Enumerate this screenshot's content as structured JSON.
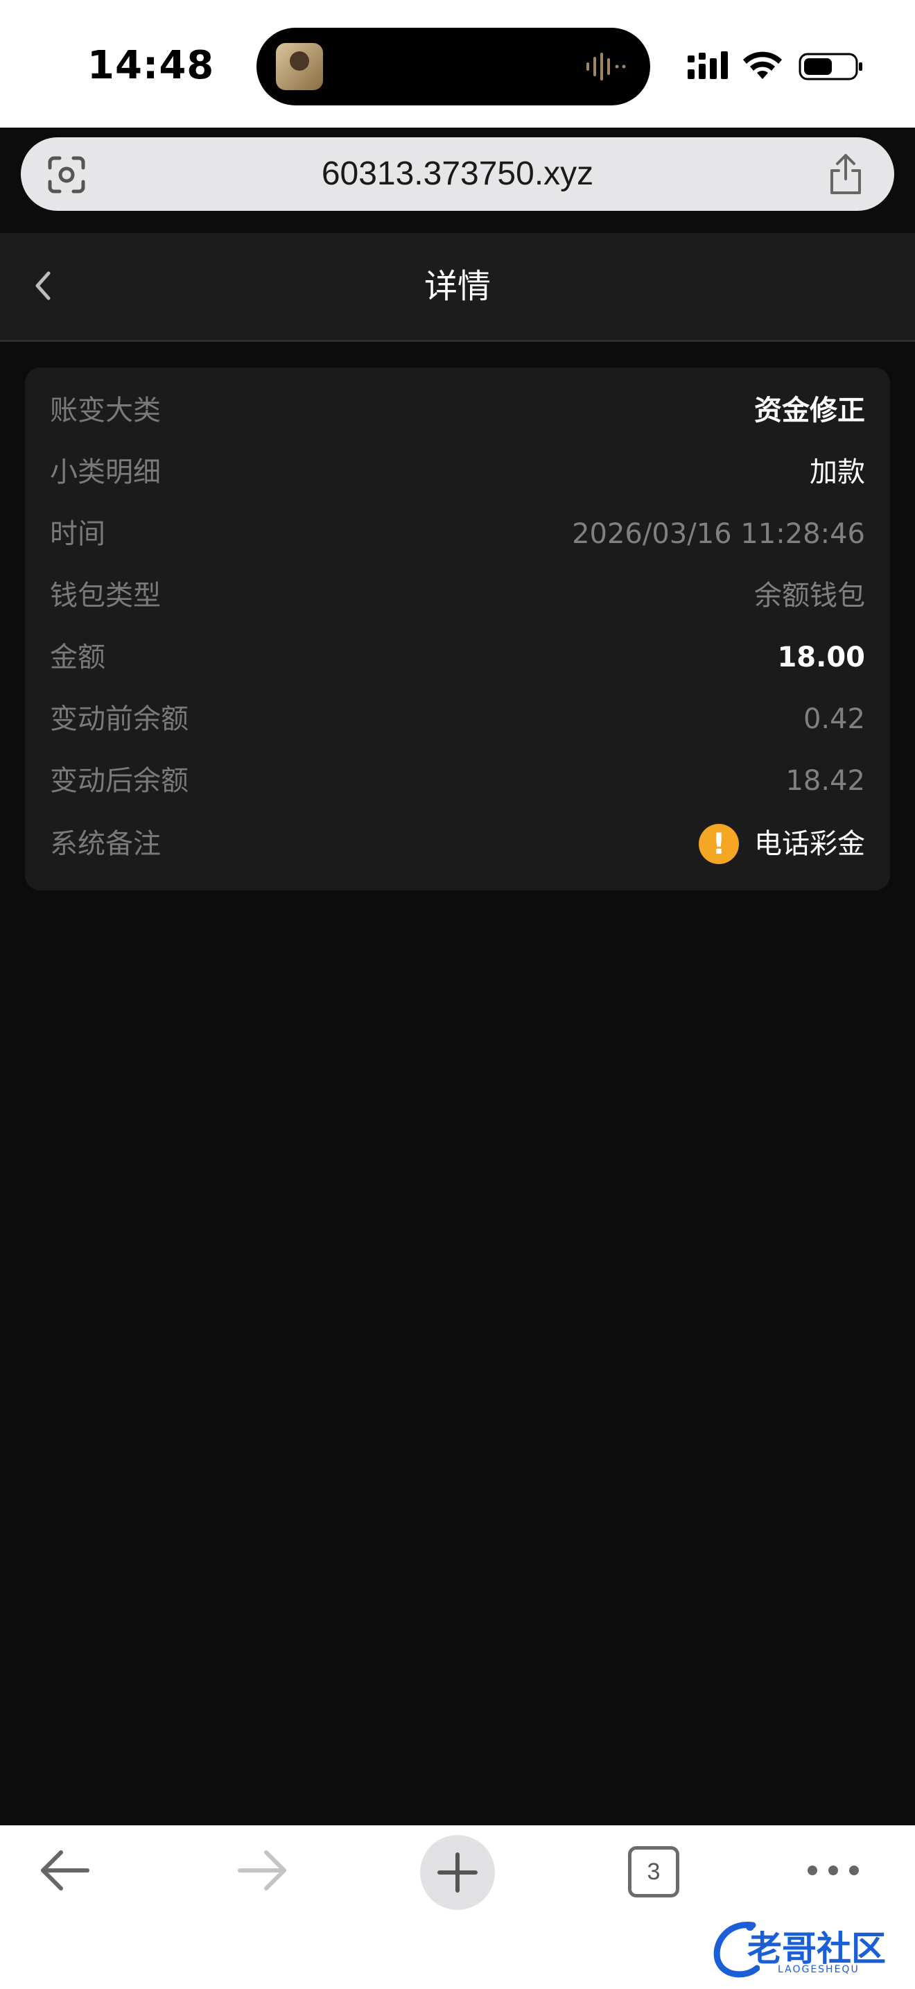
{
  "status_bar": {
    "time": "14:48"
  },
  "browser": {
    "url": "60313.373750.xyz",
    "tab_count": "3"
  },
  "header": {
    "title": "详情"
  },
  "details": [
    {
      "label": "账变大类",
      "value": "资金修正"
    },
    {
      "label": "小类明细",
      "value": "加款"
    },
    {
      "label": "时间",
      "value": "2026/03/16 11:28:46"
    },
    {
      "label": "钱包类型",
      "value": "余额钱包"
    },
    {
      "label": "金额",
      "value": "18.00"
    },
    {
      "label": "变动前余额",
      "value": "0.42"
    },
    {
      "label": "变动后余额",
      "value": "18.42"
    },
    {
      "label": "系统备注",
      "value": "电话彩金"
    }
  ],
  "watermark": {
    "text": "老哥社区",
    "sub": "LAOGESHEQU"
  },
  "colors": {
    "warning": "#f5a623",
    "card_bg": "#1b1b1b",
    "page_bg": "#0c0c0c"
  }
}
